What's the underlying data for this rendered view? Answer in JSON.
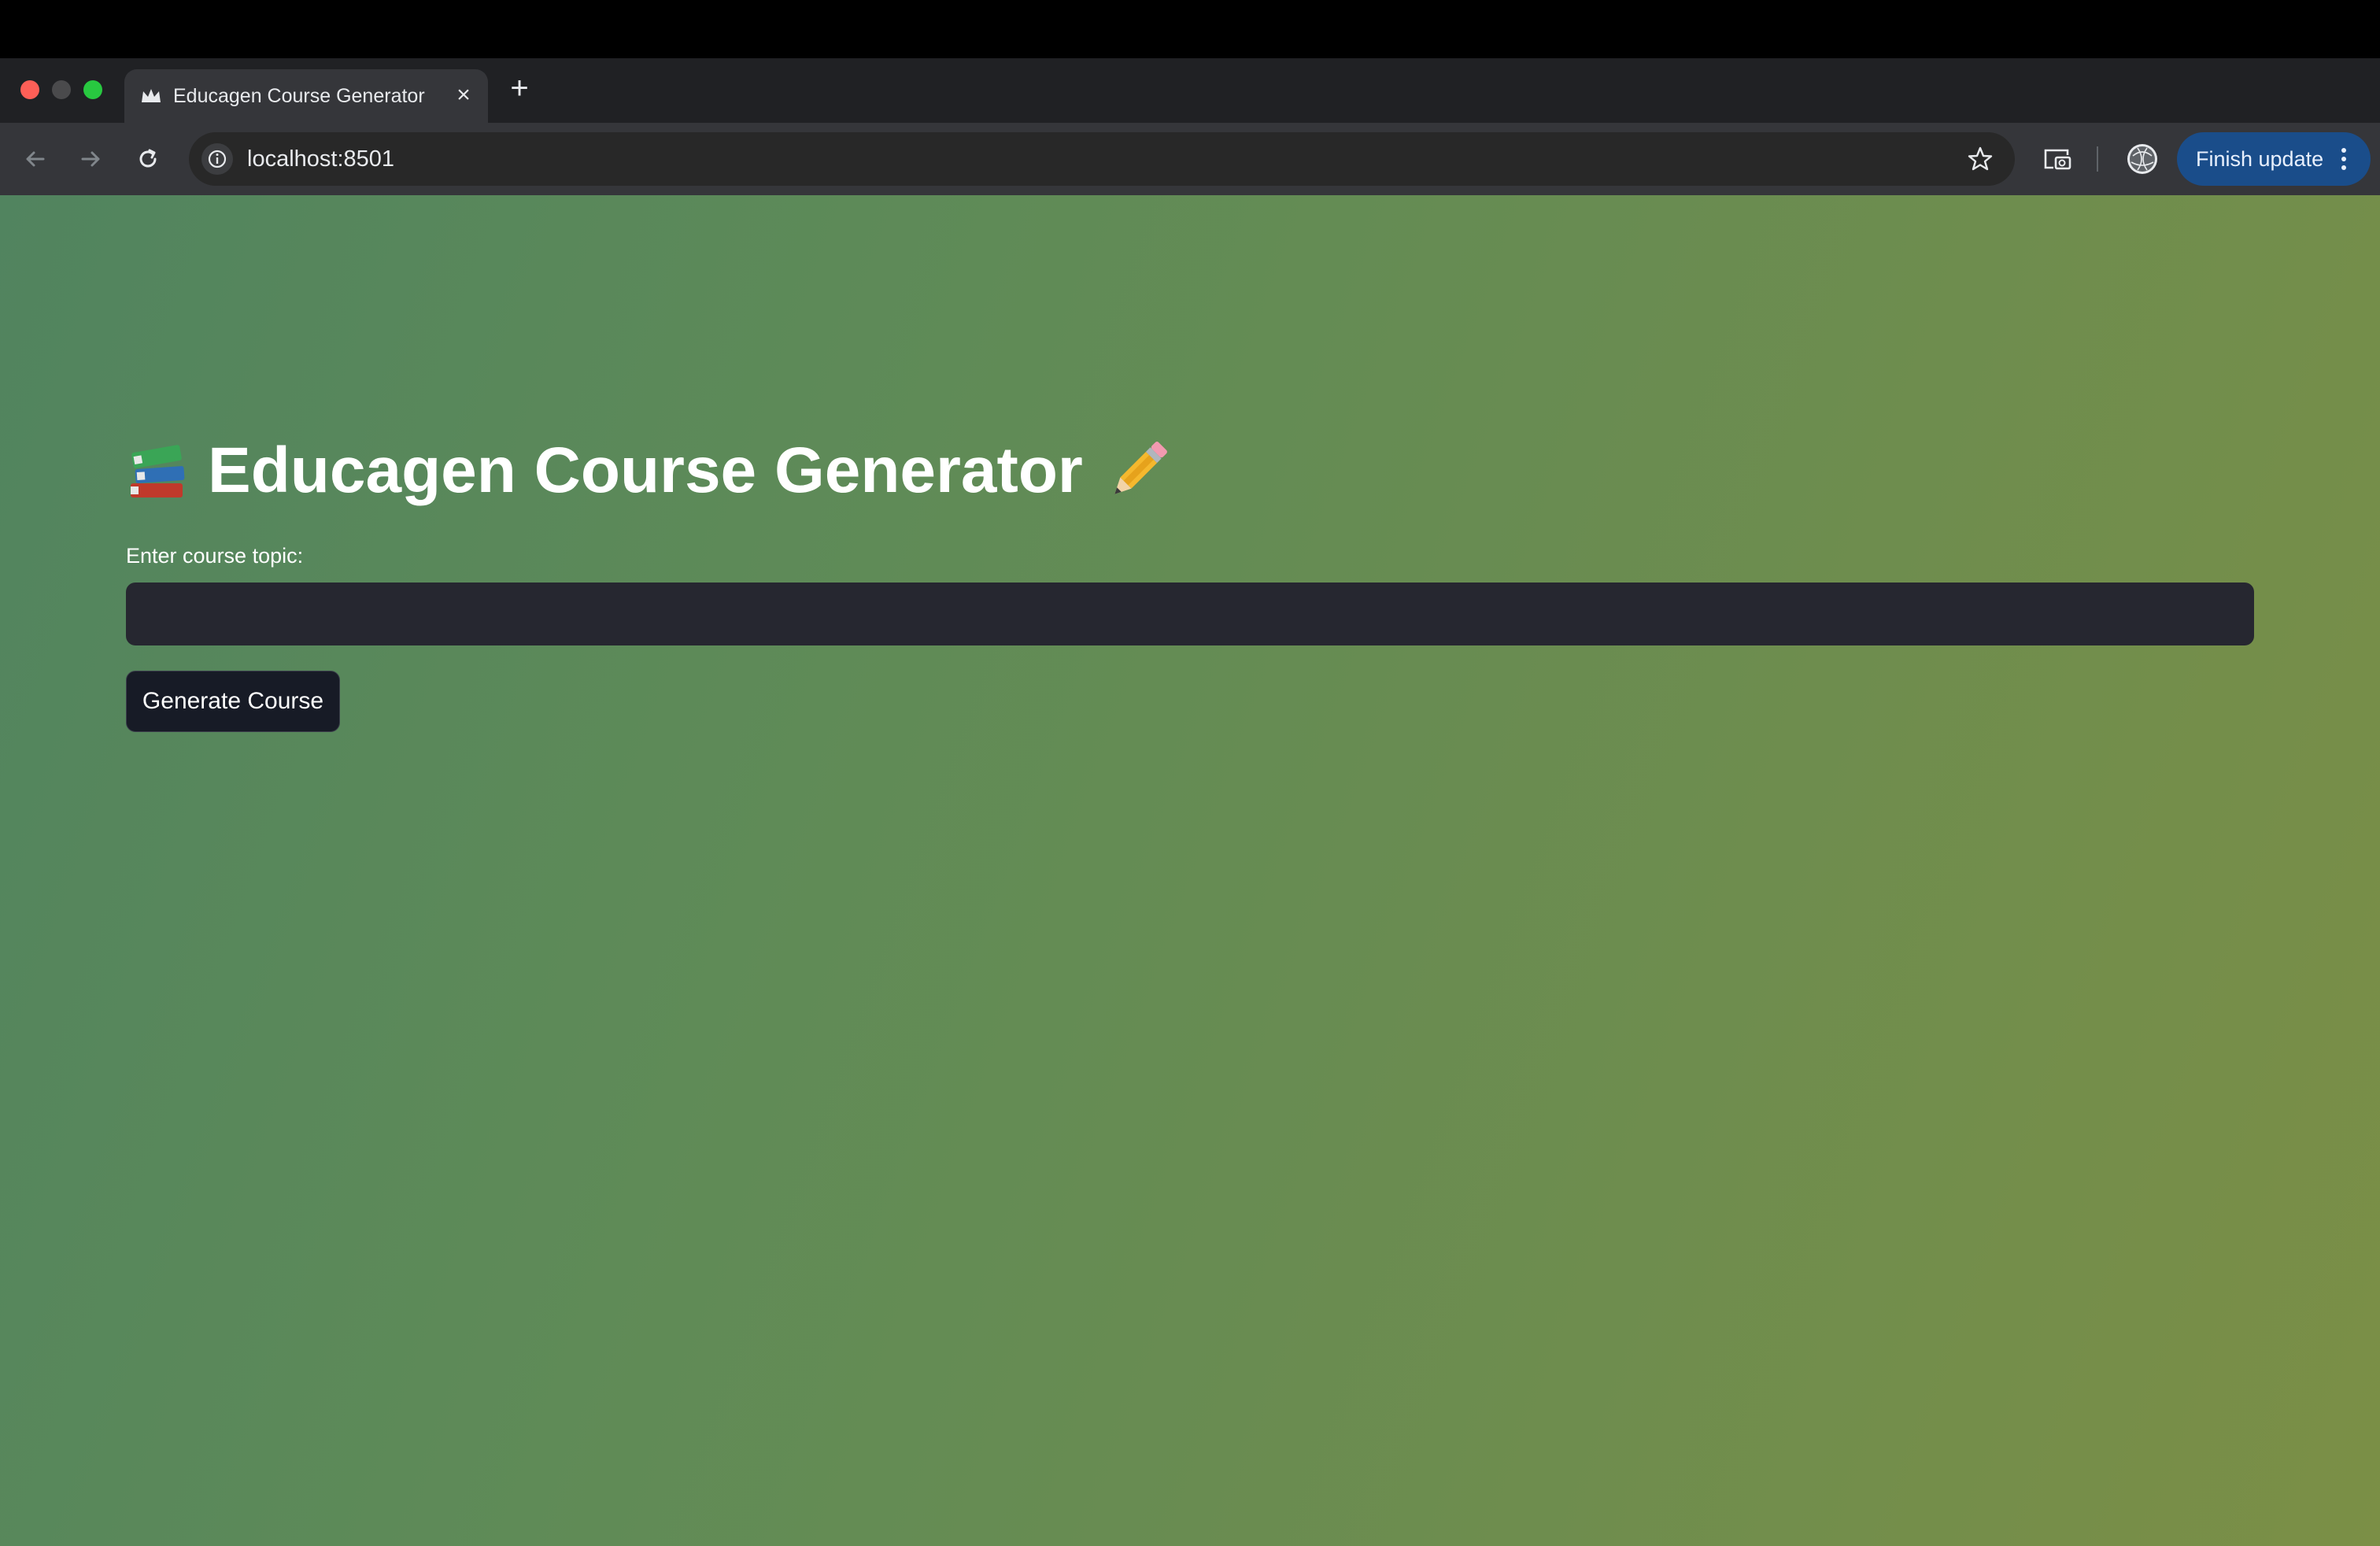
{
  "browser": {
    "tab_title": "Educagen Course Generator",
    "url": "localhost:8501",
    "finish_update_label": "Finish update",
    "update_button_color": "#1a4d8a",
    "icons": {
      "tab_favicon": "streamlit-crown-icon",
      "close": "close-icon",
      "new_tab": "plus-icon",
      "back": "back-arrow-icon",
      "forward": "forward-arrow-icon",
      "reload": "reload-icon",
      "site_info": "info-icon",
      "bookmark": "star-icon",
      "cast": "cast-search-icon",
      "profile": "profile-avatar-icon",
      "menu": "kebab-menu-icon"
    }
  },
  "page": {
    "title": "Educagen Course Generator",
    "title_prefix_icon": "books-emoji",
    "title_suffix_icon": "pencil-emoji",
    "input_label": "Enter course topic:",
    "input_value": "",
    "generate_button_label": "Generate Course",
    "background_colors": [
      "#51845f",
      "#7b8f46"
    ]
  }
}
